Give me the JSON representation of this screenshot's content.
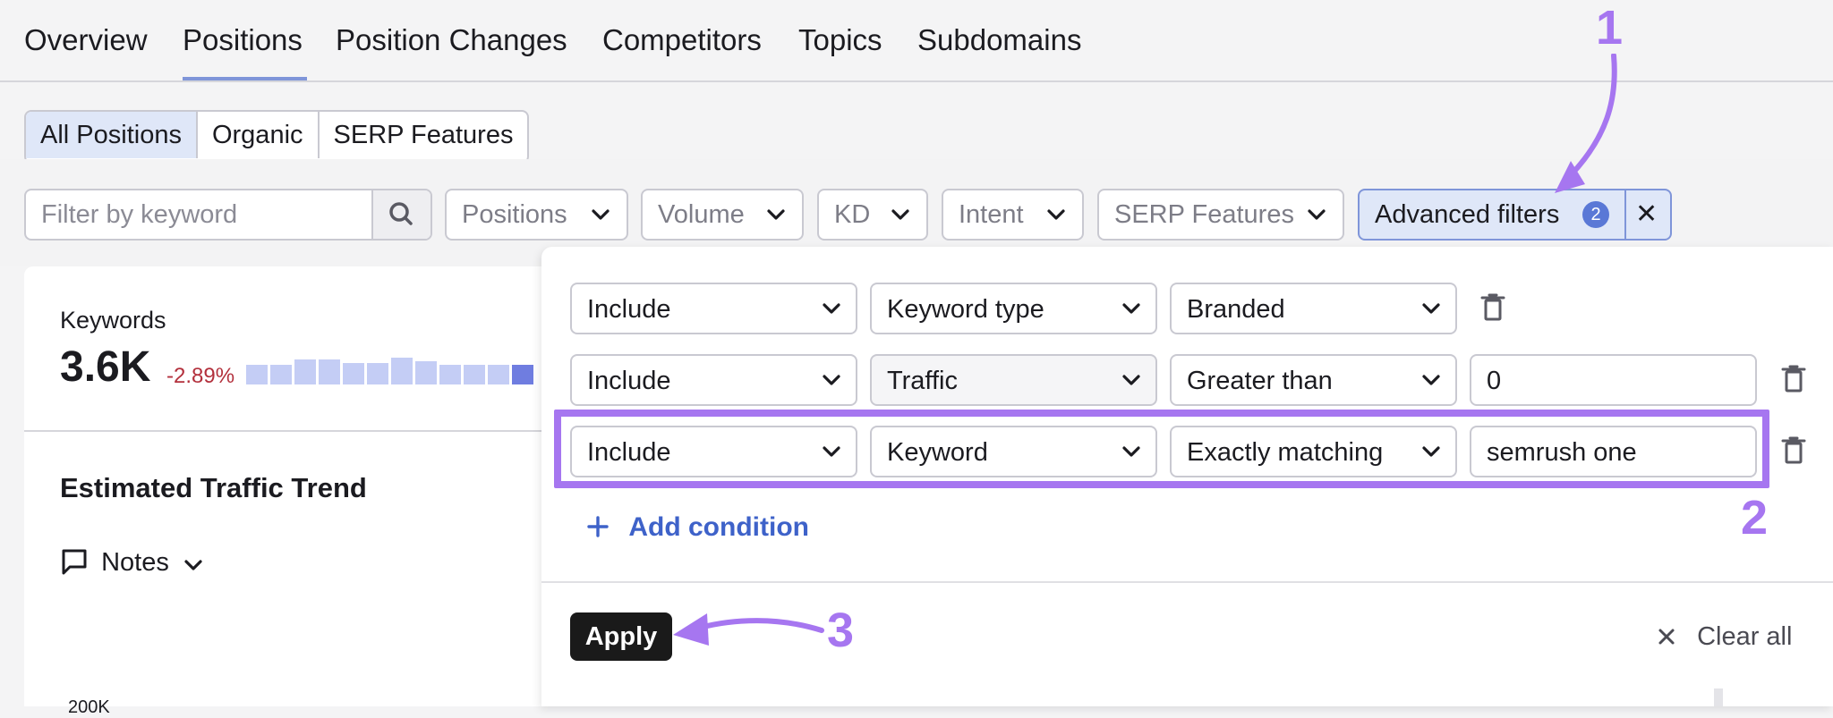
{
  "nav": {
    "tabs": [
      {
        "label": "Overview",
        "active": false
      },
      {
        "label": "Positions",
        "active": true
      },
      {
        "label": "Position Changes",
        "active": false
      },
      {
        "label": "Competitors",
        "active": false
      },
      {
        "label": "Topics",
        "active": false
      },
      {
        "label": "Subdomains",
        "active": false
      }
    ]
  },
  "segment": {
    "options": [
      {
        "label": "All Positions",
        "active": true
      },
      {
        "label": "Organic",
        "active": false
      },
      {
        "label": "SERP Features",
        "active": false
      }
    ]
  },
  "filters": {
    "search_placeholder": "Filter by keyword",
    "dropdowns": [
      "Positions",
      "Volume",
      "KD",
      "Intent",
      "SERP Features"
    ],
    "advanced": {
      "label": "Advanced filters",
      "count": "2",
      "close": "✕"
    }
  },
  "summary": {
    "keywords_label": "Keywords",
    "keywords_value": "3.6K",
    "keywords_delta": "-2.89%",
    "trend_relative_heights": [
      0.55,
      0.55,
      0.7,
      0.7,
      0.6,
      0.6,
      0.75,
      0.65,
      0.55,
      0.55,
      0.55,
      0.55
    ],
    "trend_title": "Estimated Traffic Trend",
    "notes_label": "Notes",
    "axis_cut_label": "200K"
  },
  "advanced_panel": {
    "conditions": [
      {
        "mode": "Include",
        "field": "Keyword type",
        "operator": "Branded",
        "value": null
      },
      {
        "mode": "Include",
        "field": "Traffic",
        "operator": "Greater than",
        "value": "0"
      },
      {
        "mode": "Include",
        "field": "Keyword",
        "operator": "Exactly matching",
        "value": "semrush one"
      }
    ],
    "add_condition_label": "Add condition",
    "apply_label": "Apply",
    "clear_all_label": "Clear all"
  },
  "annotations": {
    "step1": "1",
    "step2": "2",
    "step3": "3",
    "color": "#a676f0"
  },
  "colors": {
    "accent_blue": "#5a78d6",
    "link_blue": "#3e62c9",
    "negative": "#b3303c",
    "selected_bg": "#dfe7f8"
  }
}
